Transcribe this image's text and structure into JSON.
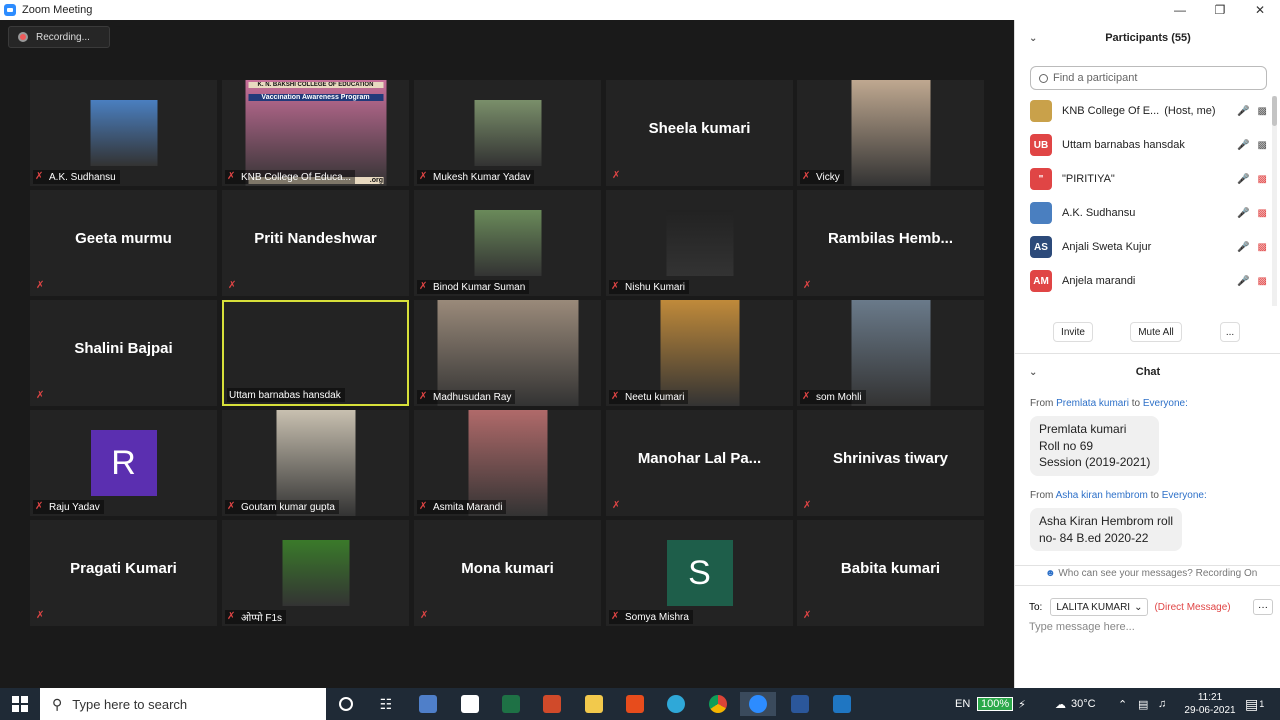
{
  "window": {
    "title": "Zoom Meeting"
  },
  "recording": {
    "label": "Recording..."
  },
  "tiles": [
    {
      "name": "A.K. Sudhansu",
      "kind": "photo",
      "photo_color": "#4a7fc0"
    },
    {
      "name": "KNB College Of Educa...",
      "kind": "photo",
      "photo_color": "#c86f9a",
      "banner_title": "K. N. BAKSHI COLLEGE OF EDUCATION",
      "banner_sub": "Vaccination Awareness Program",
      "banner_org": ".org"
    },
    {
      "name": "Mukesh Kumar Yadav",
      "kind": "photo",
      "photo_color": "#7a8f6a"
    },
    {
      "name": "Sheela kumari",
      "kind": "text"
    },
    {
      "name": "Vicky",
      "kind": "photo",
      "photo_color": "#bfa890"
    },
    {
      "name": "Geeta murmu",
      "kind": "text"
    },
    {
      "name": "Priti Nandeshwar",
      "kind": "text"
    },
    {
      "name": "Binod Kumar Suman",
      "kind": "photo",
      "photo_color": "#6a8a5a"
    },
    {
      "name": "Nishu Kumari",
      "kind": "photo",
      "photo_color": "#222222"
    },
    {
      "name": "Rambilas Hemb...",
      "kind": "text"
    },
    {
      "name": "Shalini Bajpai",
      "kind": "text"
    },
    {
      "name": "Uttam barnabas hansdak",
      "kind": "active"
    },
    {
      "name": "Madhusudan Ray",
      "kind": "photo",
      "photo_color": "#9a8a7a"
    },
    {
      "name": "Neetu kumari",
      "kind": "photo",
      "photo_color": "#c08a3a"
    },
    {
      "name": "som Mohli",
      "kind": "photo",
      "photo_color": "#6a7a8a"
    },
    {
      "name": "Raju Yadav",
      "kind": "avatar",
      "avatar_letter": "R",
      "avatar_color": "#5b2fb0"
    },
    {
      "name": "Goutam kumar gupta",
      "kind": "photo",
      "photo_color": "#c8c0b0"
    },
    {
      "name": "Asmita Marandi",
      "kind": "photo",
      "photo_color": "#b06a6a"
    },
    {
      "name": "Manohar Lal Pa...",
      "kind": "text"
    },
    {
      "name": "Shrinivas tiwary",
      "kind": "text"
    },
    {
      "name": "Pragati Kumari",
      "kind": "text"
    },
    {
      "name": "ओप्पो F1s",
      "kind": "photo",
      "photo_color": "#3a7a2a"
    },
    {
      "name": "Mona kumari",
      "kind": "text"
    },
    {
      "name": "Somya Mishra",
      "kind": "avatar",
      "avatar_letter": "S",
      "avatar_color": "#1e5e4a"
    },
    {
      "name": "Babita kumari",
      "kind": "text"
    }
  ],
  "participants": {
    "header": "Participants (55)",
    "search_placeholder": "Find a participant",
    "list": [
      {
        "name": "KNB College Of E...",
        "tag": "(Host, me)",
        "initials": "",
        "color": "#c9a14a"
      },
      {
        "name": "Uttam barnabas hansdak",
        "tag": "",
        "initials": "UB",
        "color": "#e04545"
      },
      {
        "name": "\"PIRITIYA\"",
        "tag": "",
        "initials": "\"",
        "color": "#e04545"
      },
      {
        "name": "A.K. Sudhansu",
        "tag": "",
        "initials": "",
        "color": "#4a7fc0"
      },
      {
        "name": "Anjali Sweta Kujur",
        "tag": "",
        "initials": "AS",
        "color": "#2c4a7a"
      },
      {
        "name": "Anjela marandi",
        "tag": "",
        "initials": "AM",
        "color": "#e04545"
      }
    ],
    "invite_label": "Invite",
    "mute_all_label": "Mute All",
    "more_label": "..."
  },
  "chat": {
    "header": "Chat",
    "messages": [
      {
        "from_prefix": "From",
        "from": "Premlata kumari",
        "to_word": "to",
        "to": "Everyone:",
        "lines": [
          "Premlata kumari",
          "Roll no 69",
          "Session (2019-2021)"
        ]
      },
      {
        "from_prefix": "From",
        "from": "Asha kiran hembrom",
        "to_word": "to",
        "to": "Everyone:",
        "lines": [
          "Asha Kiran Hembrom roll",
          "no- 84 B.ed 2020-22"
        ]
      }
    ],
    "who_sees": "Who can see your messages? Recording On",
    "to_label": "To:",
    "recipient": "LALITA KUMARI",
    "dm_label": "(Direct Message)",
    "more_label": "···",
    "placeholder": "Type message here..."
  },
  "taskbar": {
    "search_placeholder": "Type here to search",
    "lang": "EN",
    "battery": "100%",
    "temp": "30°C",
    "time": "11:21",
    "date": "29-06-2021",
    "notif_count": "1"
  }
}
